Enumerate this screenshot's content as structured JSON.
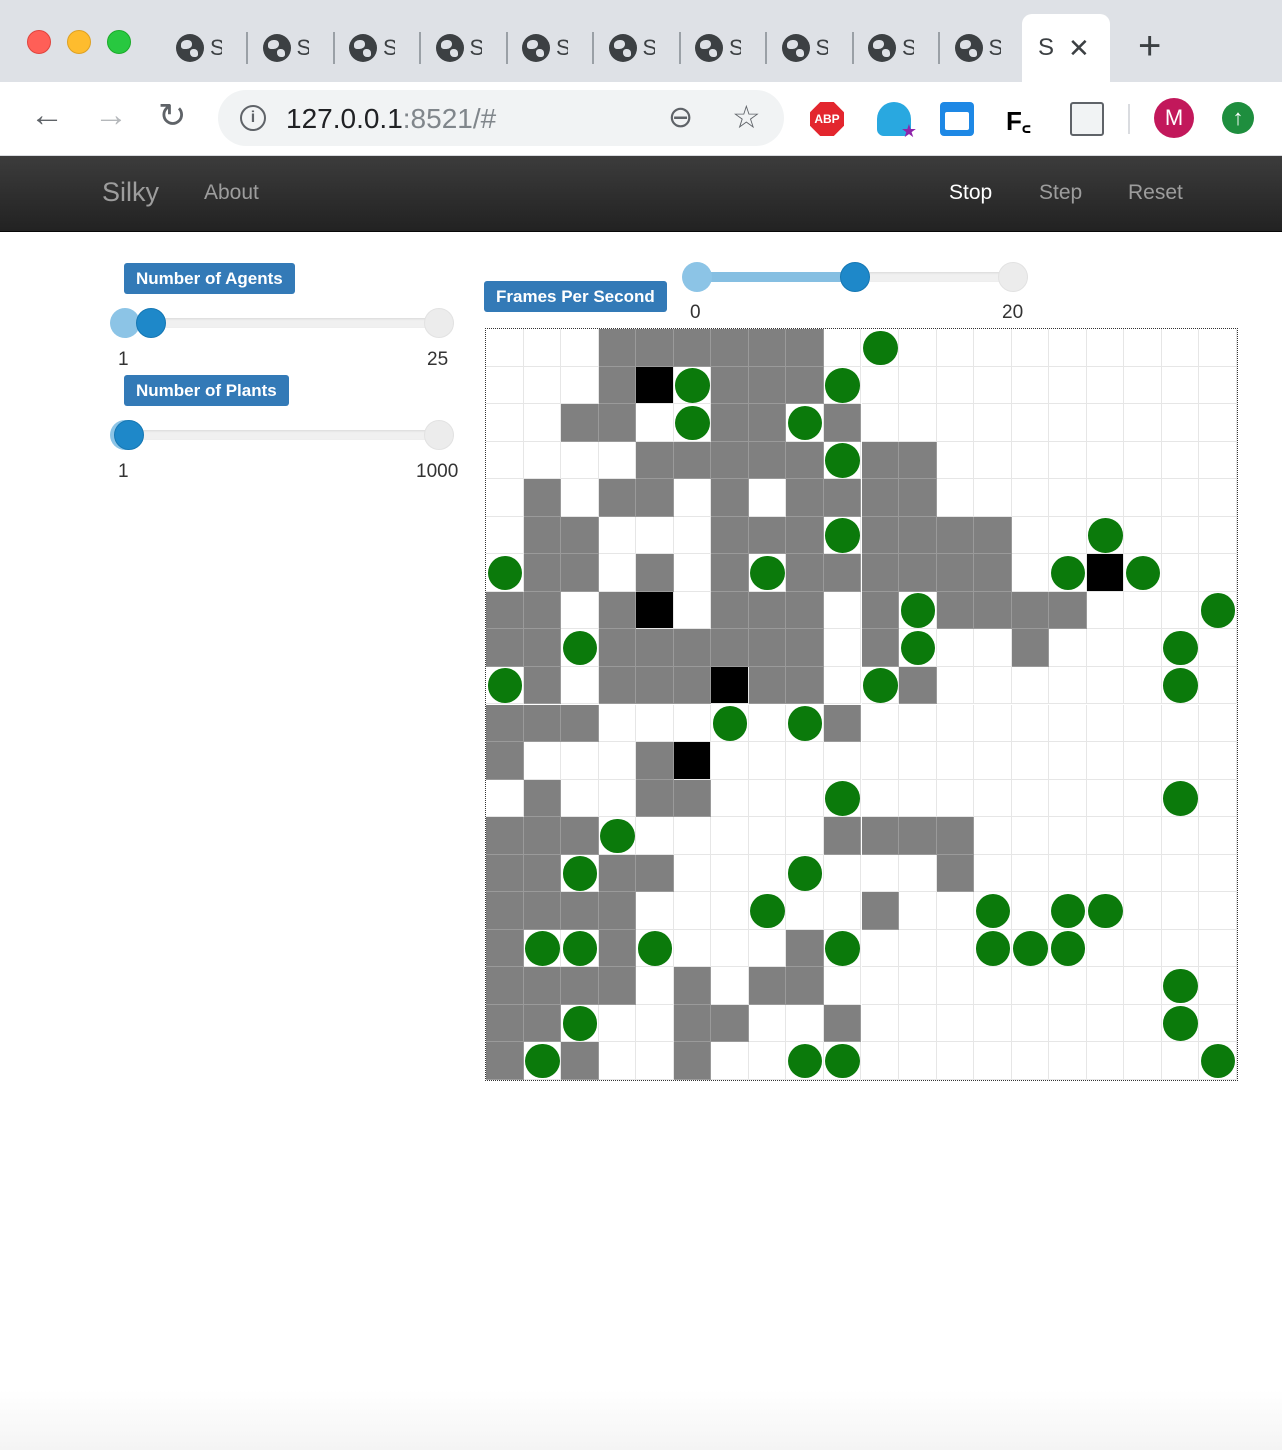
{
  "browser": {
    "tabs": [
      "S",
      "S",
      "S",
      "S",
      "S",
      "S",
      "S",
      "S",
      "S",
      "S"
    ],
    "active_tab": {
      "title": "S",
      "close": "✕"
    },
    "new_tab": "+",
    "url_host": "127.0.0.1",
    "url_rest": ":8521/#",
    "extensions": {
      "abp": "ABP",
      "fc": "F꜀"
    },
    "avatar_letter": "M"
  },
  "app": {
    "brand": "Silky",
    "nav": {
      "about": "About",
      "stop": "Stop",
      "step": "Step",
      "reset": "Reset"
    }
  },
  "controls": {
    "agents": {
      "label": "Number of Agents",
      "min": 1,
      "max": 25,
      "value": 3,
      "min_label": "1",
      "max_label": "25"
    },
    "plants": {
      "label": "Number of Plants",
      "min": 1,
      "max": 1000,
      "value": 14,
      "min_label": "1",
      "max_label": "1000"
    },
    "fps": {
      "label": "Frames Per Second",
      "min": 0,
      "max": 20,
      "value": 10,
      "min_label": "0",
      "max_label": "20"
    }
  },
  "grid": {
    "cols": 20,
    "rows": 20,
    "legend": ". = empty, g = grass, a = agent, p = plant",
    "cells": [
      "...gggggg.p.........",
      "...gapgggp..........",
      "..gg.pggpg..........",
      "....gggggpgg........",
      ".g.gg.g.gggg........",
      ".gg...gggpgggg..p...",
      "pgg.g.gpgggggg.pap..",
      "gg.ga.ggg.gpgggg...p",
      "ggpgggggg.gp..g...p.",
      "pg.gggagg.pg......p.",
      "ggg...p.pg..........",
      "g...ga..............",
      ".g..gg...p........p.",
      "gggp.....gggg.......",
      "ggpgg...p...g.......",
      "gggg...p..g..p.pp...",
      "gppgp...gp...ppp....",
      "gggg.g.gg.........p.",
      "ggp..gg..g........p.",
      "gpg..g..pp.........p"
    ]
  }
}
